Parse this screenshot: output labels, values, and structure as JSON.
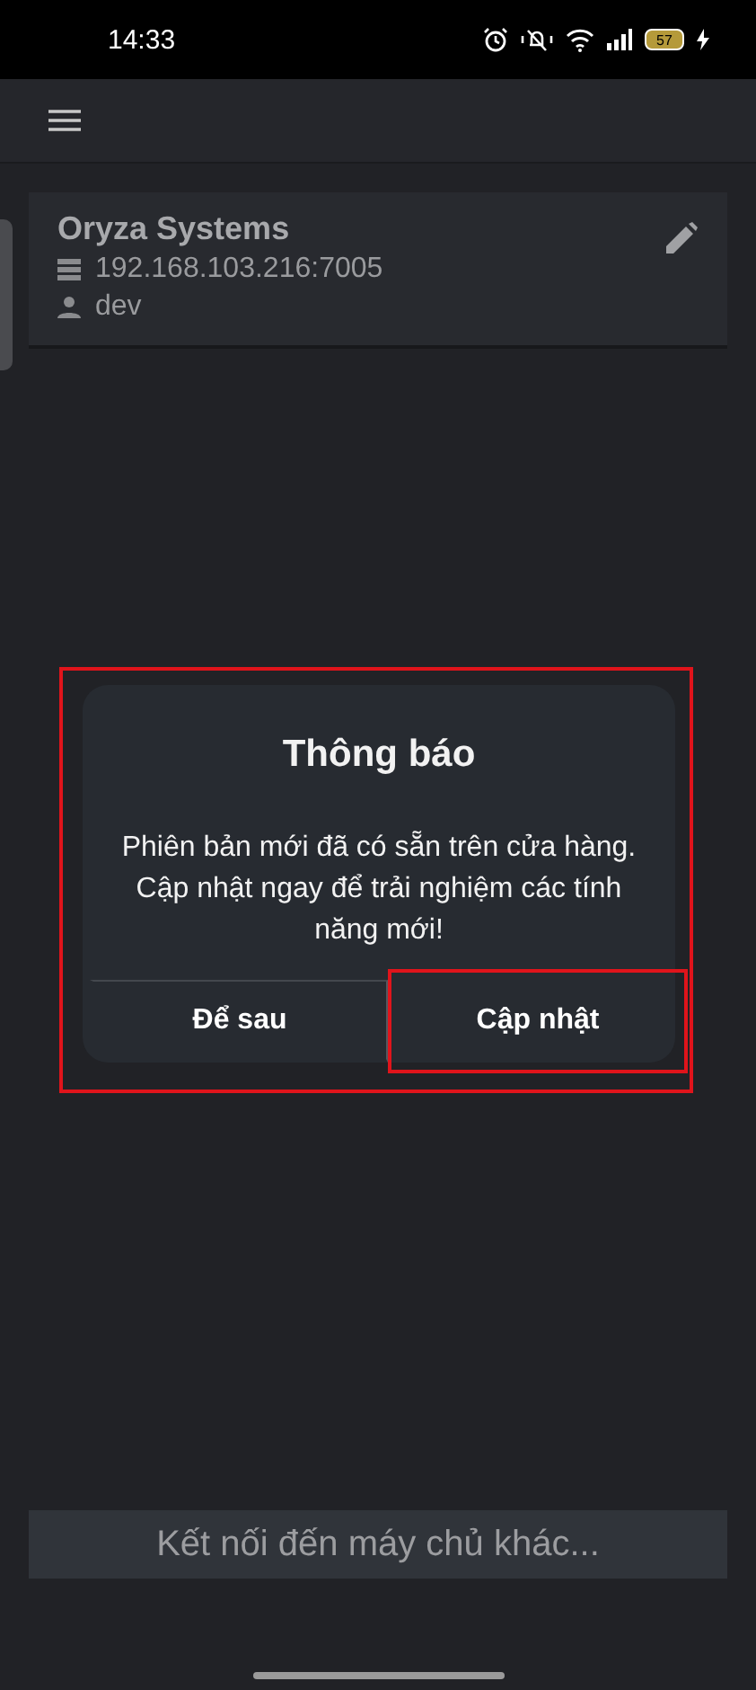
{
  "status_bar": {
    "time": "14:33",
    "battery": "57",
    "charging": true
  },
  "app_bar": {
    "menu": true
  },
  "server_card": {
    "name": "Oryza Systems",
    "address": "192.168.103.216:7005",
    "user": "dev"
  },
  "dialog": {
    "title": "Thông báo",
    "message": "Phiên bản mới đã có sẵn trên cửa hàng. Cập nhật ngay để trải nghiệm các tính năng mới!",
    "highlighted": true,
    "buttons": [
      {
        "label": "Để sau",
        "highlighted": false
      },
      {
        "label": "Cập nhật",
        "highlighted": true
      }
    ]
  },
  "connect_button": {
    "label": "Kết nối đến máy chủ khác..."
  }
}
